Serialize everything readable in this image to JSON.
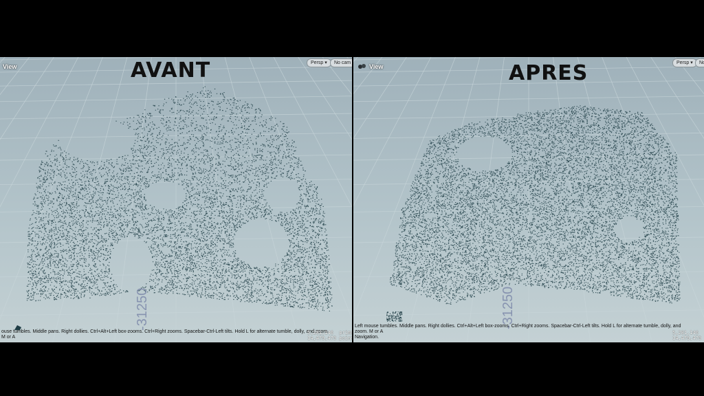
{
  "left": {
    "view_label": "View",
    "persp_label": "Persp ▾",
    "cam_label": "No cam ▾",
    "title": "AVANT",
    "axis_number": "-31250",
    "help_text": "ouse tumbles. Middle pans. Right dollies. Ctrl+Alt+Left box-zooms. Ctrl+Right zooms. Spacebar-Ctrl-Left tilts. Hold L for alternate tumble, dolly, and zoom. M or A",
    "stats_line1": "5,281,146  prims",
    "stats_line2": "14,479,479 points"
  },
  "right": {
    "view_label": "View",
    "persp_label": "Persp ▾",
    "cam_label": "No",
    "title": "APRES",
    "axis_number": "-31250",
    "help_text": "Left mouse tumbles. Middle pans. Right dollies. Ctrl+Alt+Left box-zooms. Ctrl+Right zooms. Spacebar-Ctrl-Left tilts. Hold L for alternate tumble, dolly, and zoom. M or A",
    "help_text_2": "Navigation.",
    "stats_line1": "5,281,146",
    "stats_line2": "14,479,479 p"
  },
  "colors": {
    "points": "#1f3d45",
    "grid": "#c9d6da"
  }
}
